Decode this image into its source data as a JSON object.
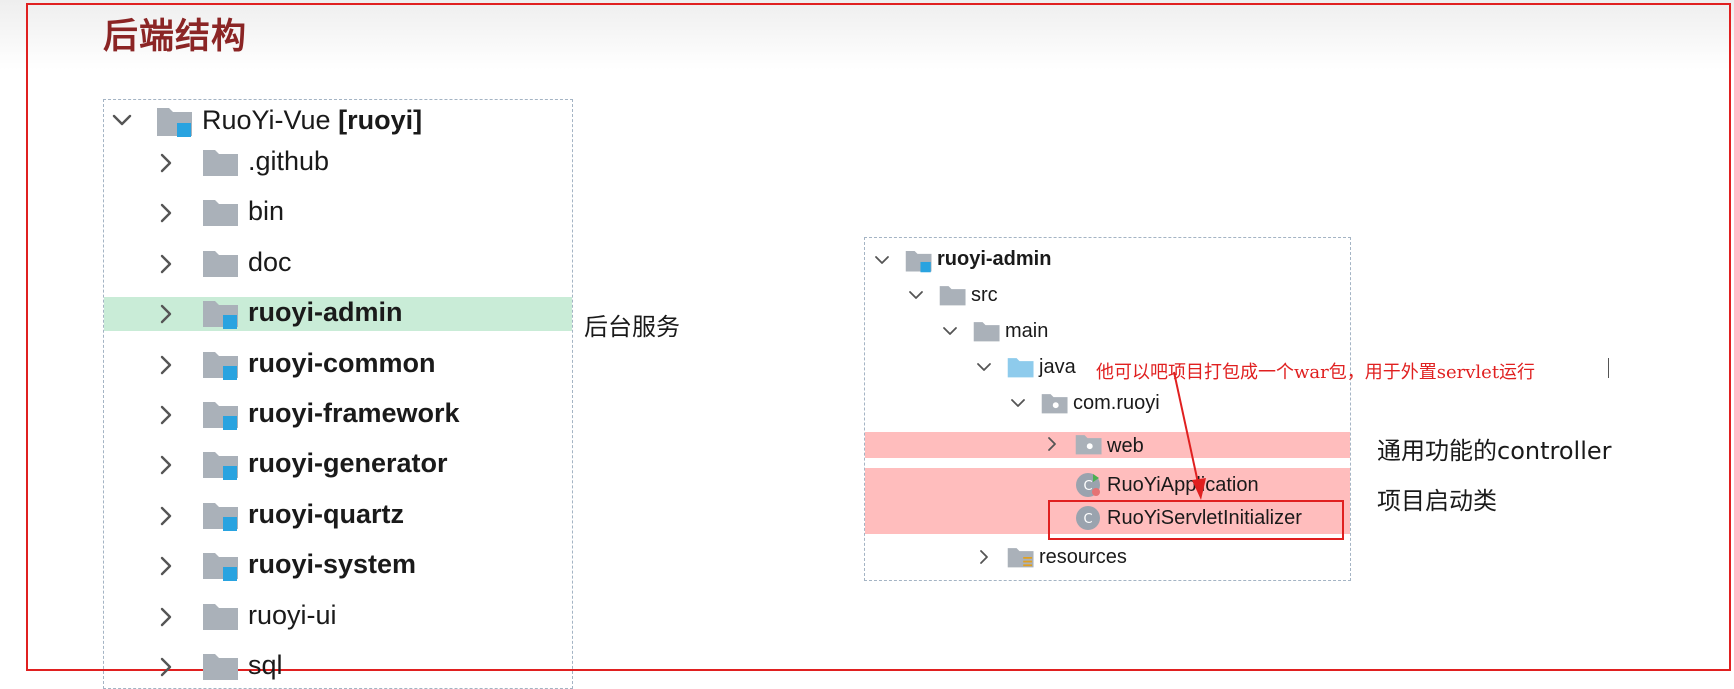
{
  "title": "后端结构",
  "left_tree": {
    "root": {
      "name": "RuoYi-Vue",
      "suffix": "[ruoyi]"
    },
    "items": [
      {
        "label": ".github",
        "bold": false,
        "module": false
      },
      {
        "label": "bin",
        "bold": false,
        "module": false
      },
      {
        "label": "doc",
        "bold": false,
        "module": false
      },
      {
        "label": "ruoyi-admin",
        "bold": true,
        "module": true,
        "selected": true
      },
      {
        "label": "ruoyi-common",
        "bold": true,
        "module": true
      },
      {
        "label": "ruoyi-framework",
        "bold": true,
        "module": true
      },
      {
        "label": "ruoyi-generator",
        "bold": true,
        "module": true
      },
      {
        "label": "ruoyi-quartz",
        "bold": true,
        "module": true
      },
      {
        "label": "ruoyi-system",
        "bold": true,
        "module": true
      },
      {
        "label": "ruoyi-ui",
        "bold": false,
        "module": false
      },
      {
        "label": "sql",
        "bold": false,
        "module": false
      }
    ]
  },
  "right_tree": {
    "root": "ruoyi-admin",
    "src": "src",
    "main": "main",
    "java": "java",
    "package": "com.ruoyi",
    "web": "web",
    "app_class": "RuoYiApplication",
    "servlet_class": "RuoYiServletInitializer",
    "resources": "resources",
    "class_badge": "C"
  },
  "annotations": {
    "admin_service": "后台服务",
    "war_note": "他可以吧项目打包成一个war包，用于外置servlet运行",
    "controller_note": "通用功能的controller",
    "startup_note": "项目启动类"
  },
  "colors": {
    "frame_red": "#e02020",
    "title_brown": "#8b2525",
    "green_highlight": "#c9ecd7",
    "red_highlight": "#ffbdbd",
    "folder_gray": "#aab1b9",
    "module_blue": "#29a3e0",
    "java_folder_blue": "#8ecbec"
  }
}
